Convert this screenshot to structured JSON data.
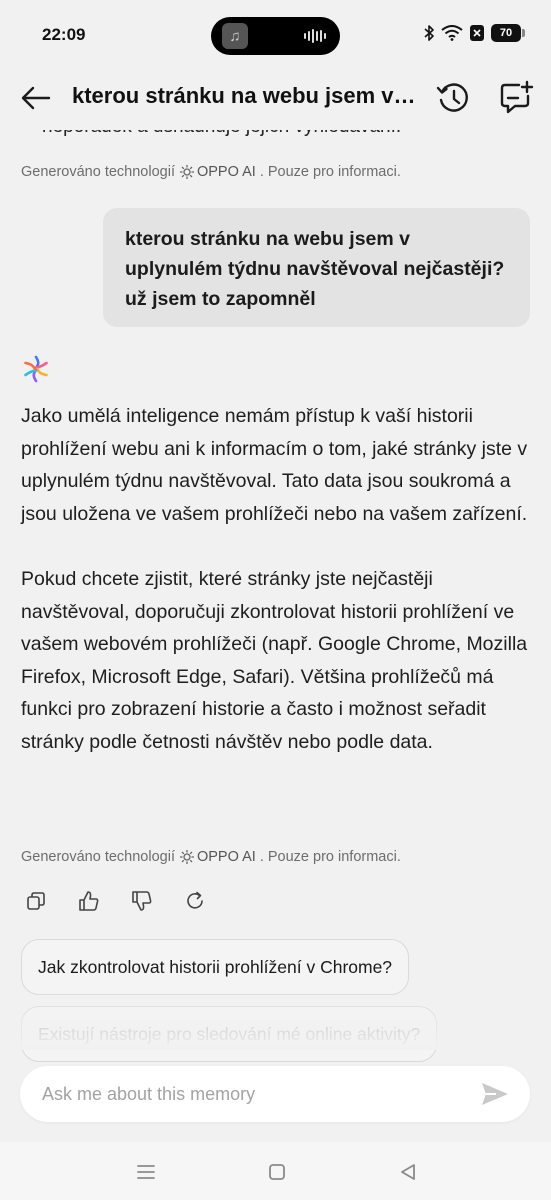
{
  "status_bar": {
    "time": "22:09",
    "battery": "70",
    "icons": [
      "music-icon",
      "audio-wave-icon",
      "bluetooth-icon",
      "wifi-icon",
      "no-sim-icon",
      "battery-icon"
    ]
  },
  "header": {
    "title": "kterou stránku na webu jsem v ...",
    "icons": [
      "back-arrow-icon",
      "history-clock-icon",
      "new-chat-icon"
    ]
  },
  "chat": {
    "cut_off_text": "neporádek a usnadňuje jejich vyhledávání.",
    "generated_note_prefix": "Generováno technologií",
    "generated_note_brand": "OPPO AI",
    "generated_note_suffix": ". Pouze pro informaci.",
    "user_message": "kterou stránku na webu jsem v uplynulém týdnu navštěvoval nejčastěji? už jsem to zapomněl",
    "ai_paragraphs": [
      "Jako umělá inteligence nemám přístup k vaší historii prohlížení webu ani k informacím o tom, jaké stránky jste v uplynulém týdnu navštěvoval. Tato data jsou soukromá a jsou uložena ve vašem prohlížeči nebo na vašem zařízení.",
      "Pokud chcete zjistit, které stránky jste nejčastěji navštěvoval, doporučuji zkontrolovat historii prohlížení ve vašem webovém prohlížeči (např. Google Chrome, Mozilla Firefox, Microsoft Edge, Safari). Většina prohlížečů má funkci pro zobrazení historie a často i možnost seřadit stránky podle četnosti návštěv nebo podle data."
    ],
    "actions": [
      "copy-icon",
      "thumbs-up-icon",
      "thumbs-down-icon",
      "regenerate-icon"
    ],
    "suggestions": [
      "Jak zkontrolovat historii prohlížení v Chrome?",
      "Existují nástroje pro sledování mé online aktivity?"
    ]
  },
  "input": {
    "placeholder": "Ask me about this memory"
  },
  "nav_bar": {
    "icons": [
      "menu-icon",
      "home-icon",
      "back-triangle-icon"
    ]
  }
}
